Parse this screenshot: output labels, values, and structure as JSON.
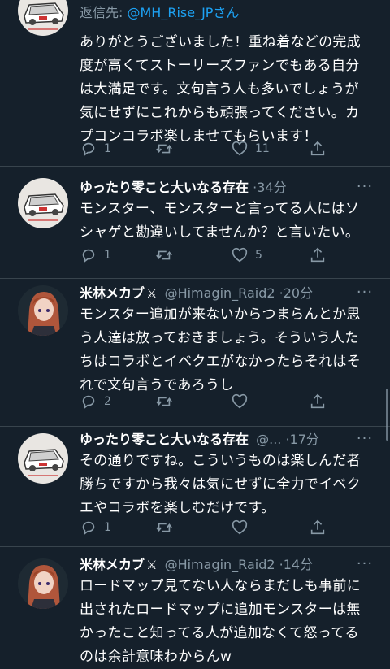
{
  "colors": {
    "background": "#15202b",
    "text": "#ffffff",
    "muted": "#8899a6",
    "accent": "#1da1f2",
    "divider": "#38444d"
  },
  "tweets": [
    {
      "avatar": "car-illustration-avatar",
      "reply_to_prefix": "返信先: ",
      "reply_to_mention": "@MH_Rise_JPさん",
      "text_lines": [
        "ありがとうございました！重ね着などの完成",
        "度が高くてストーリーズファンでもある自分",
        "は大満足です。文句言う人も多いでしょうが",
        "気にせずにこれからも頑張ってください。カ",
        "プコンコラボ楽しませてもらいます！"
      ],
      "reply_count": "1",
      "retweet_count": "",
      "like_count": "11"
    },
    {
      "avatar": "car-illustration-avatar",
      "name": "ゆったり零こと大いなる存在",
      "handle": "",
      "separator": "·",
      "time": "34分",
      "text_lines": [
        "モンスター、モンスターと言ってる人にはソ",
        "シャゲと勘違いしてませんか？と言いたい。"
      ],
      "reply_count": "1",
      "retweet_count": "",
      "like_count": "5"
    },
    {
      "avatar": "anime-character-avatar",
      "name": "米林メカブ",
      "name_suffix": "⚔",
      "handle": "@Himagin_Raid2",
      "separator": "·",
      "time": "20分",
      "text_lines": [
        "モンスター追加が来ないからつまらんとか思",
        "う人達は放っておきましょう。そういう人た",
        "ちはコラボとイベクエがなかったらそれはそ",
        "れで文句言うであろうし"
      ],
      "reply_count": "2",
      "retweet_count": "",
      "like_count": ""
    },
    {
      "avatar": "car-illustration-avatar",
      "name": "ゆったり零こと大いなる存在",
      "handle": "@...",
      "separator": "·",
      "time": "17分",
      "text_lines": [
        "その通りですね。こういうものは楽しんだ者",
        "勝ちですから我々は気にせずに全力でイベク",
        "エやコラボを楽しむだけです。"
      ],
      "reply_count": "1",
      "retweet_count": "",
      "like_count": ""
    },
    {
      "avatar": "anime-character-avatar",
      "name": "米林メカブ",
      "name_suffix": "⚔",
      "handle": "@Himagin_Raid2",
      "separator": "·",
      "time": "14分",
      "text_lines": [
        "ロードマップ見てない人ならまだしも事前に",
        "出されたロードマップに追加モンスターは無",
        "かったこと知ってる人が追加なくて怒ってる",
        "のは余計意味わからんw"
      ]
    }
  ],
  "more_label": "···"
}
